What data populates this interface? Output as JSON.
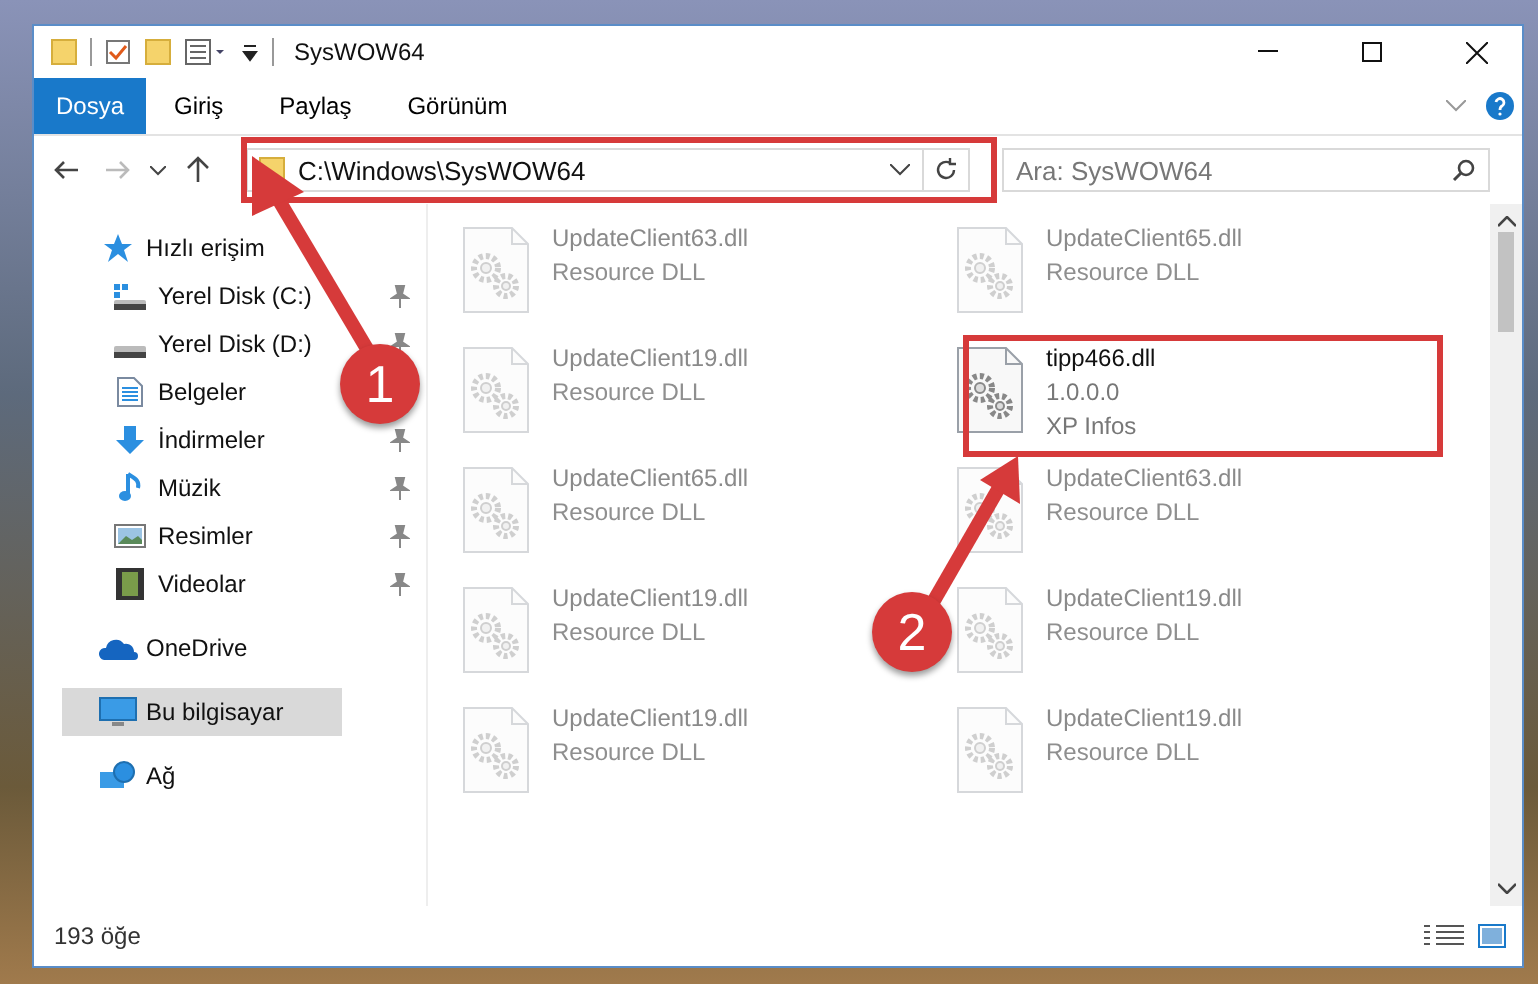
{
  "window": {
    "title": "SysWOW64"
  },
  "ribbon": {
    "tabs": [
      {
        "label": "Dosya",
        "kind": "file"
      },
      {
        "label": "Giriş",
        "kind": "tab"
      },
      {
        "label": "Paylaş",
        "kind": "tab"
      },
      {
        "label": "Görünüm",
        "kind": "tab"
      }
    ]
  },
  "address_bar": {
    "path": "C:\\Windows\\SysWOW64"
  },
  "search": {
    "placeholder": "Ara: SysWOW64"
  },
  "navigation": {
    "items": [
      {
        "label": "Hızlı erişim",
        "kind": "star",
        "pinned": false,
        "selected": false,
        "children": [
          {
            "label": "Yerel Disk (C:)",
            "kind": "system-drive",
            "pinned": true,
            "selected": false
          },
          {
            "label": "Yerel Disk (D:)",
            "kind": "drive",
            "pinned": true,
            "selected": false
          },
          {
            "label": "Belgeler",
            "kind": "document",
            "pinned": false,
            "selected": false
          },
          {
            "label": "İndirmeler",
            "kind": "download",
            "pinned": true,
            "selected": false
          },
          {
            "label": "Müzik",
            "kind": "music",
            "pinned": true,
            "selected": false
          },
          {
            "label": "Resimler",
            "kind": "picture",
            "pinned": true,
            "selected": false
          },
          {
            "label": "Videolar",
            "kind": "video",
            "pinned": true,
            "selected": false
          }
        ]
      },
      {
        "label": "OneDrive",
        "kind": "cloud",
        "pinned": false,
        "selected": false
      },
      {
        "label": "Bu bilgisayar",
        "kind": "computer",
        "pinned": false,
        "selected": true
      },
      {
        "label": "Ağ",
        "kind": "network",
        "pinned": false,
        "selected": false
      }
    ]
  },
  "files": [
    {
      "name": "UpdateClient63.dll",
      "details": [
        "Resource DLL"
      ],
      "dimmed": true
    },
    {
      "name": "UpdateClient65.dll",
      "details": [
        "Resource DLL"
      ],
      "dimmed": true
    },
    {
      "name": "UpdateClient19.dll",
      "details": [
        "Resource DLL"
      ],
      "dimmed": true
    },
    {
      "name": "tipp466.dll",
      "details": [
        "1.0.0.0",
        "XP Infos"
      ],
      "dimmed": false
    },
    {
      "name": "UpdateClient65.dll",
      "details": [
        "Resource DLL"
      ],
      "dimmed": true
    },
    {
      "name": "UpdateClient63.dll",
      "details": [
        "Resource DLL"
      ],
      "dimmed": true
    },
    {
      "name": "UpdateClient19.dll",
      "details": [
        "Resource DLL"
      ],
      "dimmed": true
    },
    {
      "name": "UpdateClient19.dll",
      "details": [
        "Resource DLL"
      ],
      "dimmed": true
    },
    {
      "name": "UpdateClient19.dll",
      "details": [
        "Resource DLL"
      ],
      "dimmed": true
    },
    {
      "name": "UpdateClient19.dll",
      "details": [
        "Resource DLL"
      ],
      "dimmed": true
    }
  ],
  "status_bar": {
    "count": "193 öğe"
  },
  "annotations": [
    {
      "label": "1"
    },
    {
      "label": "2"
    }
  ]
}
